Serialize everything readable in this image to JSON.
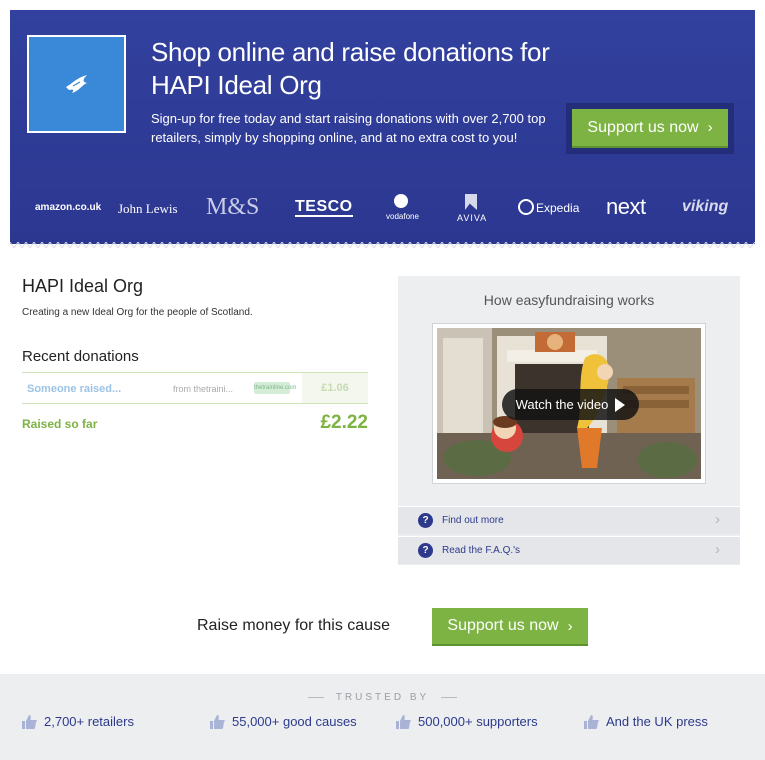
{
  "hero": {
    "title": "Shop online and raise donations for HAPI Ideal Org",
    "subtitle": "Sign-up for free today and start raising donations with over 2,700 top retailers, simply by shopping online, and at no extra cost to you!",
    "cta_label": "Support us now",
    "brands": [
      "amazon.co.uk",
      "John Lewis",
      "M&S",
      "TESCO",
      "vodafone",
      "AVIVA",
      "Expedia",
      "next",
      "viking"
    ]
  },
  "org": {
    "name": "HAPI Ideal Org",
    "description": "Creating a new Ideal Org for the people of Scotland."
  },
  "donations": {
    "title": "Recent donations",
    "rows": [
      {
        "name": "Someone raised...",
        "from": "from thetraini...",
        "logo": "thetrainline.com",
        "amount": "£1.06"
      }
    ],
    "raised_label": "Raised so far",
    "raised_value": "£2.22"
  },
  "how_it_works": {
    "title": "How easyfundraising works",
    "video_label": "Watch the video",
    "links": [
      "Find out more",
      "Read the F.A.Q.'s"
    ]
  },
  "raise": {
    "text": "Raise money for this cause",
    "cta_label": "Support us now"
  },
  "trusted": {
    "label": "TRUSTED BY",
    "items": [
      "2,700+ retailers",
      "55,000+ good causes",
      "500,000+ supporters",
      "And the UK press"
    ]
  },
  "colors": {
    "hero_bg": "#2e3a94",
    "accent_green": "#7cb342",
    "link_blue": "#2d3a8c",
    "logo_blue": "#3a89d8"
  }
}
